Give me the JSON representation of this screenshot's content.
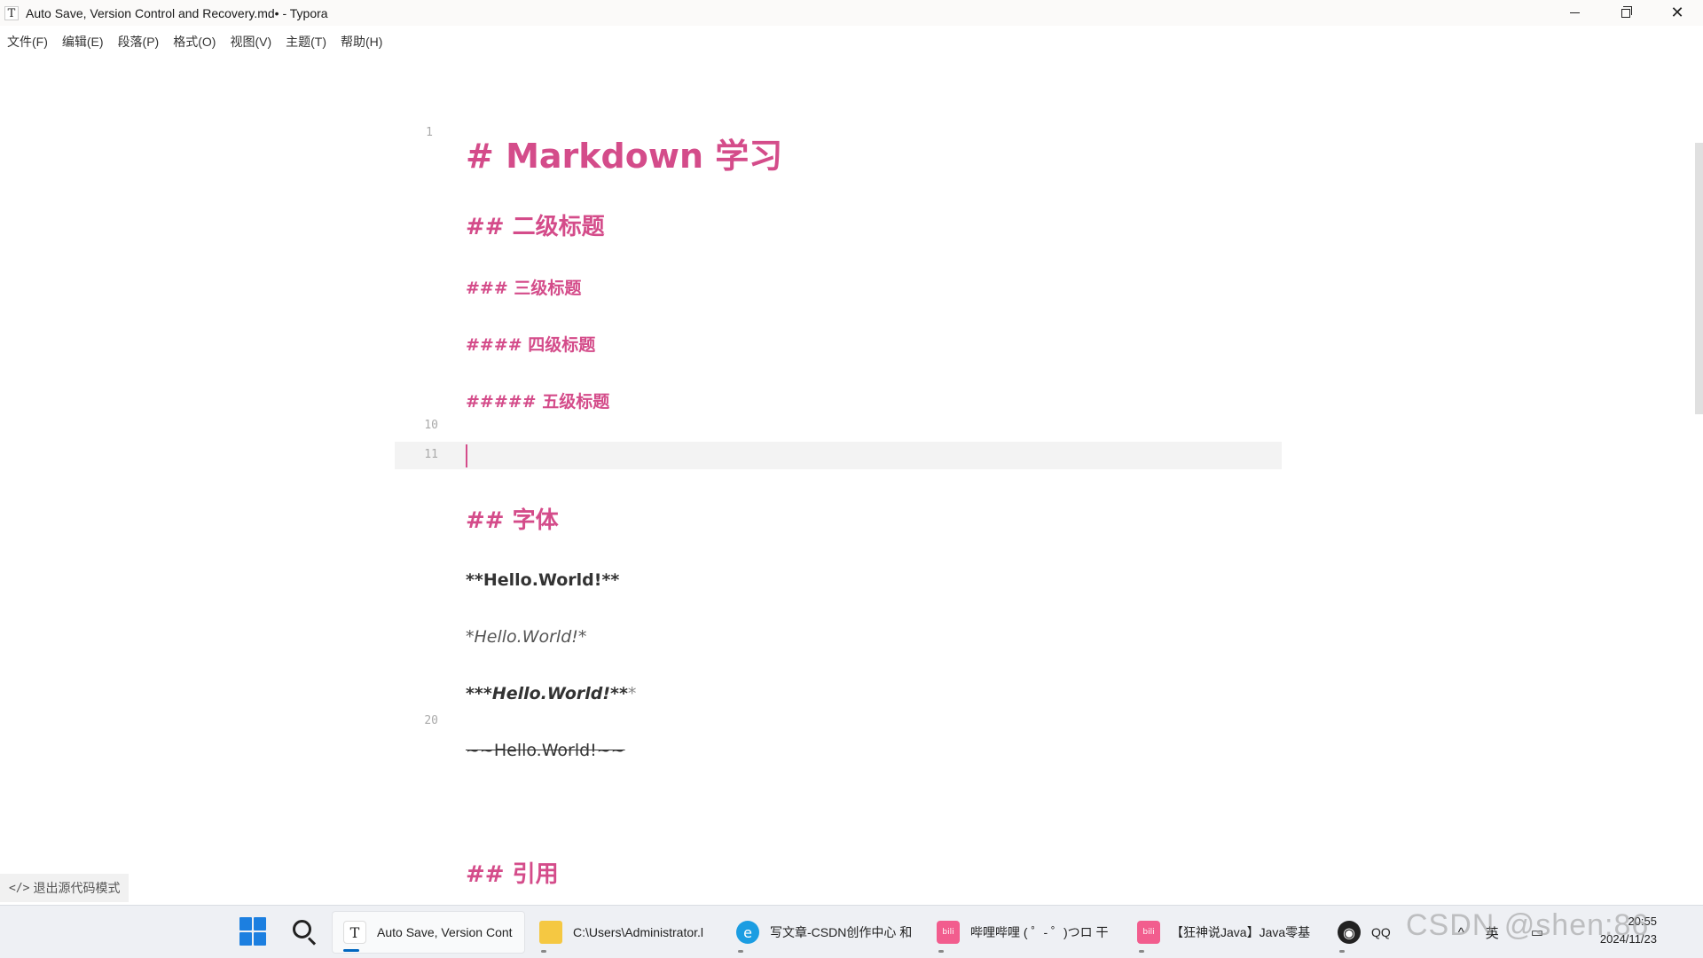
{
  "window": {
    "title": "Auto Save, Version Control and Recovery.md• - Typora",
    "app_icon": "T"
  },
  "menu": [
    "文件(F)",
    "编辑(E)",
    "段落(P)",
    "格式(O)",
    "视图(V)",
    "主题(T)",
    "帮助(H)"
  ],
  "editor": {
    "line_numbers": [
      "1",
      "10",
      "11",
      "20"
    ],
    "lines": {
      "h1": "# Markdown 学习",
      "h2": "## 二级标题",
      "h3": "### 三级标题",
      "h4": "#### 四级标题",
      "h5": "##### 五级标题",
      "h2_font": "## 字体",
      "bold": "**Hello.World!**",
      "italic": "*Hello.World!*",
      "bold_italic_prefix": "***",
      "bold_italic_text": "Hello.World!",
      "bold_italic_suffix": "**",
      "bold_italic_tail": "*",
      "strike": "~~Hello.World!~~",
      "h2_quote": "## 引用"
    },
    "source_toggle": "退出源代码模式"
  },
  "taskbar": {
    "tasks": [
      {
        "label": "Auto Save, Version Cont",
        "icon": "typora-icon"
      },
      {
        "label": "C:\\Users\\Administrator.l",
        "icon": "folder-icon"
      },
      {
        "label": "写文章-CSDN创作中心 和",
        "icon": "edge-icon"
      },
      {
        "label": "哔哩哔哩 ( ゜- ゜)つロ 干",
        "icon": "bilibili-icon"
      },
      {
        "label": "【狂神说Java】Java零基",
        "icon": "bilibili-icon"
      },
      {
        "label": "QQ",
        "icon": "qq-icon"
      }
    ],
    "tray": {
      "chevron": "^",
      "ime": "英",
      "time": "20:55",
      "date": "2024/11/23"
    }
  },
  "watermark": "CSDN @shen:86",
  "colors": {
    "heading": "#d44c8a",
    "caret": "#d44c8a",
    "active_task": "#0067c0"
  }
}
